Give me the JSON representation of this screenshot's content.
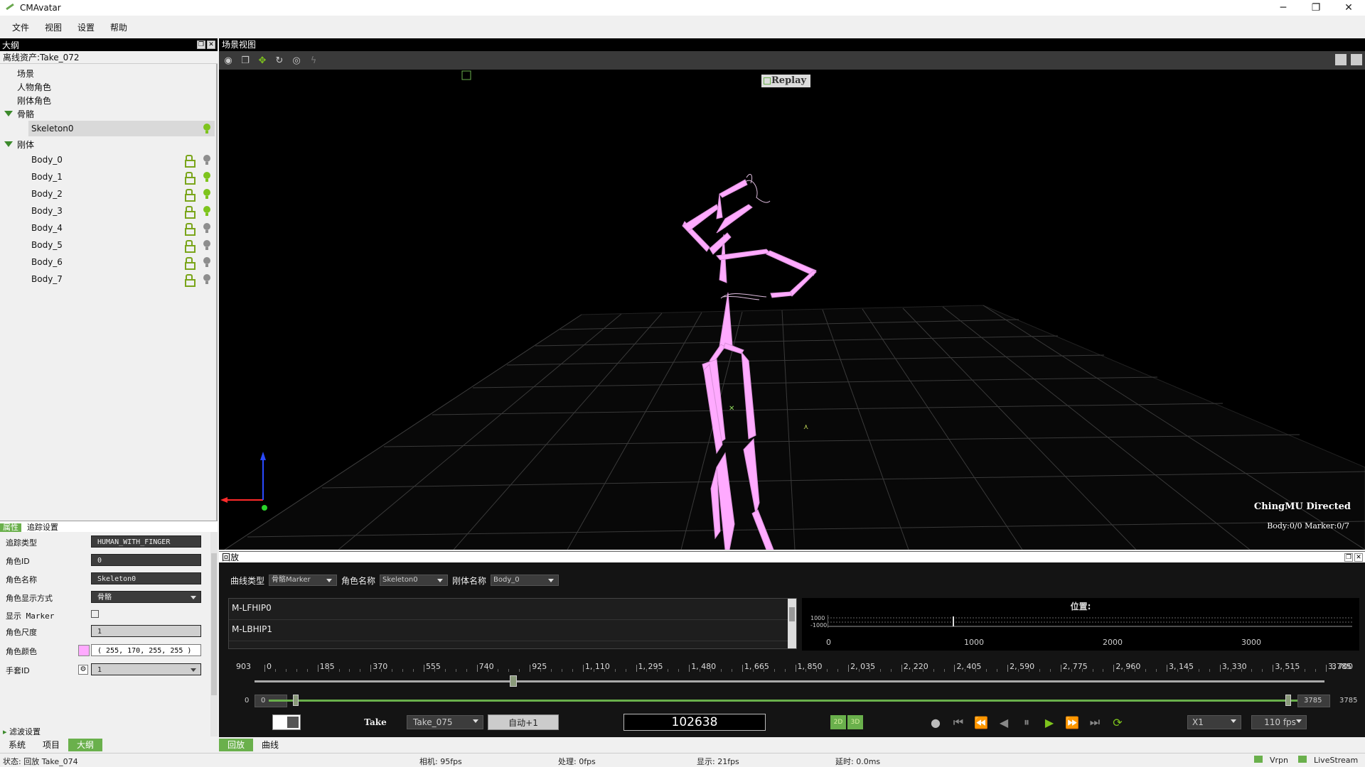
{
  "titlebar": {
    "title": "CMAvatar",
    "minimize": "─",
    "maximize": "❐",
    "close": "✕"
  },
  "menu": [
    "文件",
    "视图",
    "设置",
    "帮助"
  ],
  "outline": {
    "title": "大纲",
    "asset": "离线资产:Take_072",
    "tree": [
      {
        "label": "场景"
      },
      {
        "label": "人物角色"
      },
      {
        "label": "刚体角色"
      },
      {
        "label": "骨骼"
      },
      {
        "label": "Skeleton0"
      },
      {
        "label": "刚体"
      },
      {
        "label": "Body_0"
      },
      {
        "label": "Body_1"
      },
      {
        "label": "Body_2"
      },
      {
        "label": "Body_3"
      },
      {
        "label": "Body_4"
      },
      {
        "label": "Body_5"
      },
      {
        "label": "Body_6"
      },
      {
        "label": "Body_7"
      }
    ]
  },
  "properties": {
    "title": "属性",
    "section": "追踪设置",
    "rows": [
      {
        "label": "追踪类型",
        "value": "HUMAN_WITH_FINGER"
      },
      {
        "label": "角色ID",
        "value": "0"
      },
      {
        "label": "角色名称",
        "value": "Skeleton0"
      },
      {
        "label": "角色显示方式",
        "value": "骨骼"
      },
      {
        "label": "显示 Marker",
        "value": ""
      },
      {
        "label": "角色尺度",
        "value": "1"
      },
      {
        "label": "角色颜色",
        "value": "( 255,  170,  255,  255 )"
      },
      {
        "label": "手套ID",
        "value": "1"
      }
    ],
    "filter": "滤波设置"
  },
  "left_tabs": [
    "系统",
    "项目",
    "大纲"
  ],
  "scene": {
    "title": "场景视图",
    "replay": "Replay",
    "directed": "ChingMU Directed",
    "counts": "Body:0/0  Marker:0/7"
  },
  "playback": {
    "title": "回放",
    "filters": {
      "curve_type_label": "曲线类型",
      "curve_type": "骨骼Marker",
      "role_name_label": "角色名称",
      "role_name": "Skeleton0",
      "body_name_label": "刚体名称",
      "body_name": "Body_0"
    },
    "curves": [
      "M-LFHIP0",
      "M-LBHIP1"
    ],
    "position_title": "位置:",
    "pos_y_ticks": [
      "1000",
      "-1000"
    ],
    "pos_x_ticks": [
      "0",
      "1000",
      "2000",
      "3000"
    ],
    "ruler_start_label": "903",
    "ruler_end_label": "3785",
    "ruler_ticks": [
      "0",
      "185",
      "370",
      "555",
      "740",
      "925",
      "1, 110",
      "1, 295",
      "1, 480",
      "1, 665",
      "1, 850",
      "2, 035",
      "2, 220",
      "2, 405",
      "2, 590",
      "2, 775",
      "2, 960",
      "3, 145",
      "3, 330",
      "3, 515",
      "3, 700"
    ],
    "range_min_label": "0",
    "range_min": "0",
    "range_max": "3785",
    "range_max_label": "3785",
    "take_label": "Take",
    "take_name": "Take_075",
    "auto_button": "自动+1",
    "frame": "102638",
    "btn_2d": "2D",
    "btn_3d": "3D",
    "speed": "X1",
    "fps": "110 fps"
  },
  "bottom_tabs": [
    "回放",
    "曲线"
  ],
  "status": {
    "state": "状态: 回放 Take_074",
    "camera": "相机: 95fps",
    "process": "处理: 0fps",
    "display": "显示: 21fps",
    "delay": "延时: 0.0ms",
    "vrpn": "Vrpn",
    "livestream": "LiveStream"
  },
  "colors": {
    "accent": "#6ab04c",
    "skeleton": "#ffaaff"
  }
}
